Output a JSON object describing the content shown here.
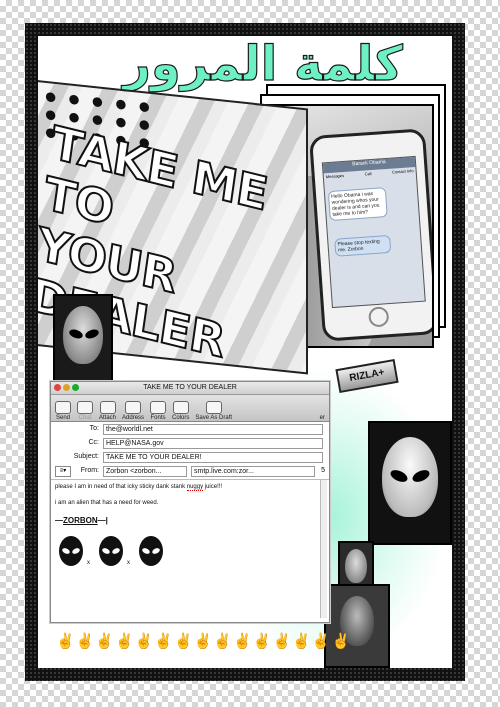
{
  "arabic_title": "كلمة المرور",
  "poster_text": [
    "TAKE ME TO",
    "YOUR DEALER"
  ],
  "phone": {
    "contact": "Barack Obama",
    "messages_label": "Messages",
    "call_label": "Call",
    "contact_info_label": "Contact Info",
    "msg1": "Hello Obama i was wondering whos your dealer is and can you take me to him?",
    "msg2": "Please stop texting me. Zorbon"
  },
  "rizla": "RIZLA+",
  "mail": {
    "window_title": "TAKE ME TO YOUR DEALER",
    "toolbar": [
      "Send",
      "Chat",
      "Attach",
      "Address",
      "Fonts",
      "Colors",
      "Save As Draft"
    ],
    "toolbar_right": "er",
    "to_label": "To:",
    "to": "the@worldl.net",
    "cc_label": "Cc:",
    "cc": "HELP@NASA.gov",
    "subject_label": "Subject:",
    "subject": "TAKE ME TO YOUR DEALER!",
    "from_label": "From:",
    "from": "Zorbon <zorbon...",
    "smtp": "smtp.live.com:zor...",
    "count": "5",
    "body_line1_before": "please I am in need of that icky sticky dank stank ",
    "body_line1_misspelled": "nuggy",
    "body_line1_after": " juice!!!",
    "body_line2": "i am an alien that has a need for weed.",
    "signature": "ZORBON",
    "times": [
      "x",
      "x"
    ]
  },
  "peace_signs": "✌✌✌✌✌✌✌✌✌✌✌✌✌✌✌",
  "colors": {
    "mint": "#6ef0c5",
    "frame": "#111111"
  }
}
